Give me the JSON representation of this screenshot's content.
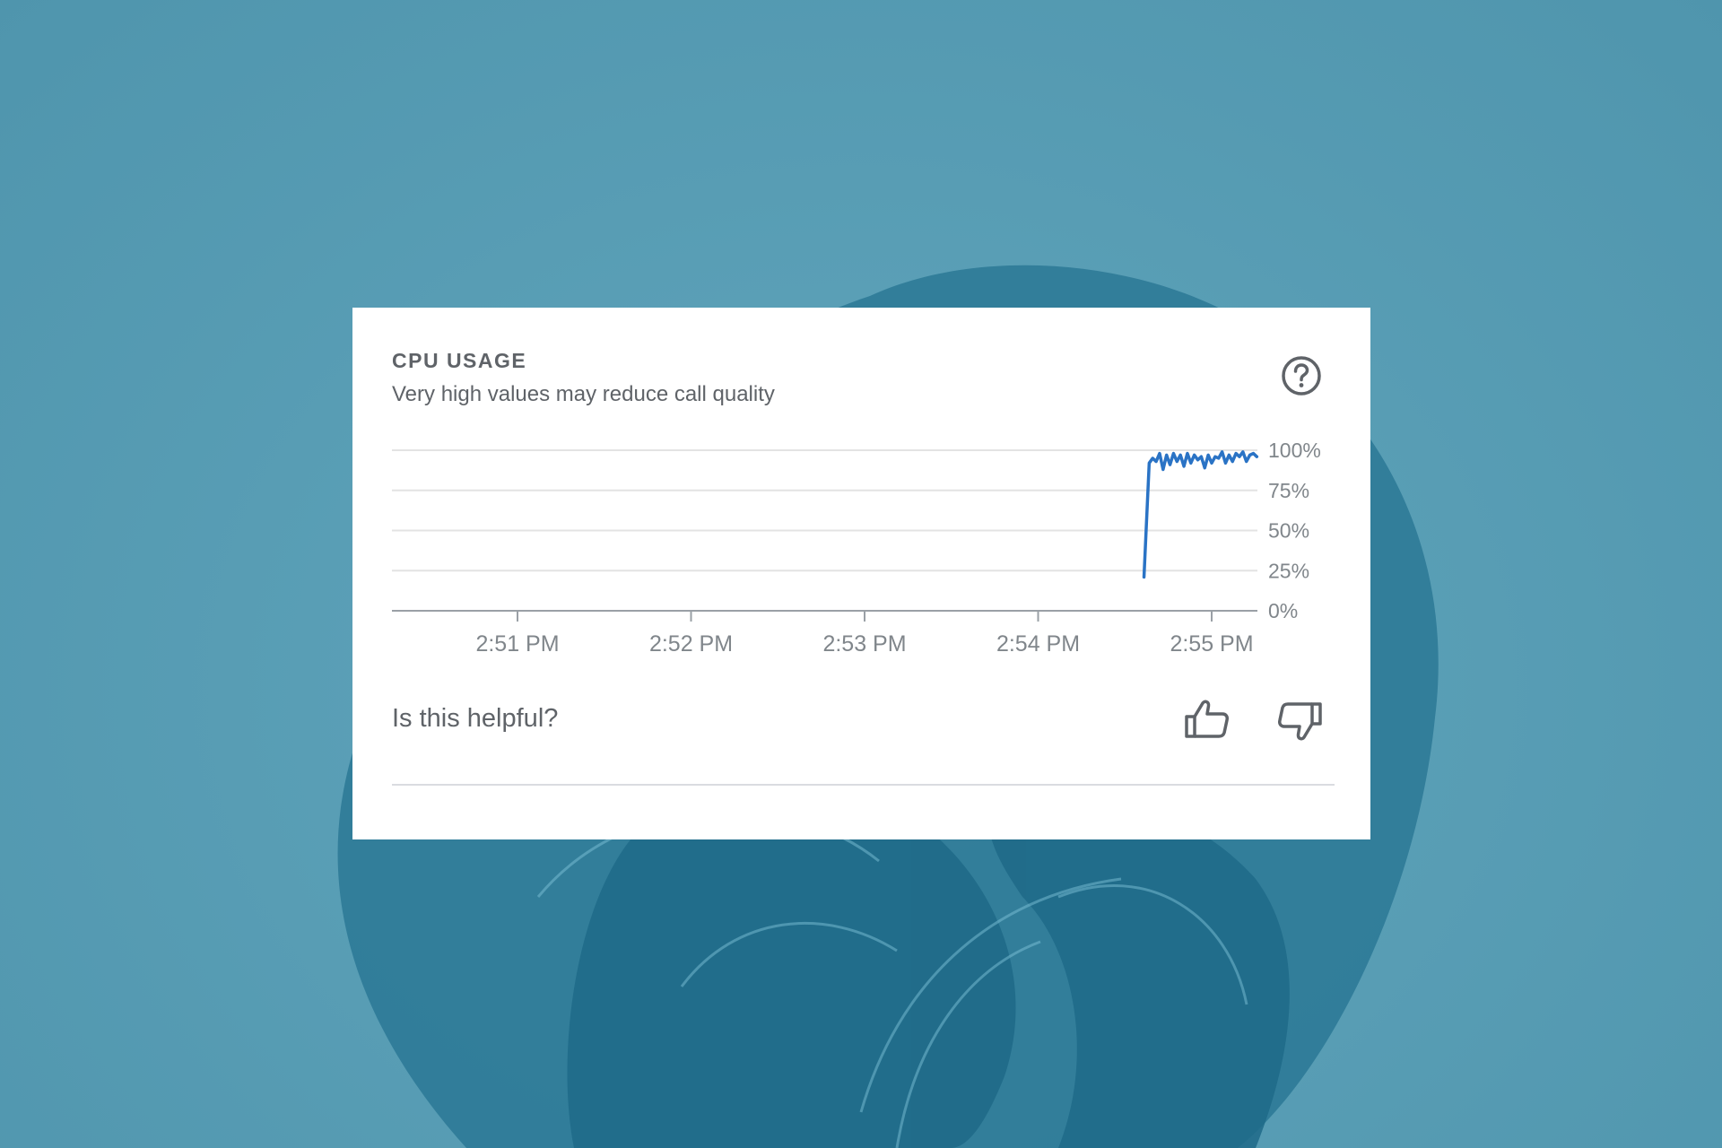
{
  "card": {
    "title": "CPU USAGE",
    "subtitle": "Very high values may reduce call quality",
    "feedback_prompt": "Is this helpful?"
  },
  "icons": {
    "help": "help-circle-icon",
    "thumb_up": "thumb-up-icon",
    "thumb_down": "thumb-down-icon"
  },
  "colors": {
    "line": "#2a73c5",
    "grid": "#e3e3e3",
    "axis": "#9aa0a6",
    "text": "#5f6368"
  },
  "chart_data": {
    "type": "line",
    "title": "CPU USAGE",
    "subtitle": "Very high values may reduce call quality",
    "x_ticks": [
      "2:51 PM",
      "2:52 PM",
      "2:53 PM",
      "2:54 PM",
      "2:55 PM"
    ],
    "y_ticks": [
      "0%",
      "25%",
      "50%",
      "75%",
      "100%"
    ],
    "ylim": [
      0,
      100
    ],
    "grid": true,
    "y_axis_side": "right",
    "series": [
      {
        "x": [
          4.61,
          4.64,
          4.66,
          4.68,
          4.7,
          4.72,
          4.74,
          4.76,
          4.78,
          4.8,
          4.82,
          4.84,
          4.86,
          4.88,
          4.9,
          4.92,
          4.94,
          4.96,
          4.98,
          5.0,
          5.02,
          5.04,
          5.06,
          5.08,
          5.1,
          5.12,
          5.14,
          5.16,
          5.18,
          5.2,
          5.22,
          5.24,
          5.26
        ],
        "y": [
          21,
          92,
          95,
          93,
          98,
          88,
          97,
          91,
          98,
          93,
          97,
          90,
          98,
          92,
          97,
          94,
          96,
          89,
          97,
          92,
          96,
          95,
          99,
          92,
          97,
          93,
          98,
          96,
          99,
          93,
          97,
          98,
          96
        ]
      }
    ]
  }
}
